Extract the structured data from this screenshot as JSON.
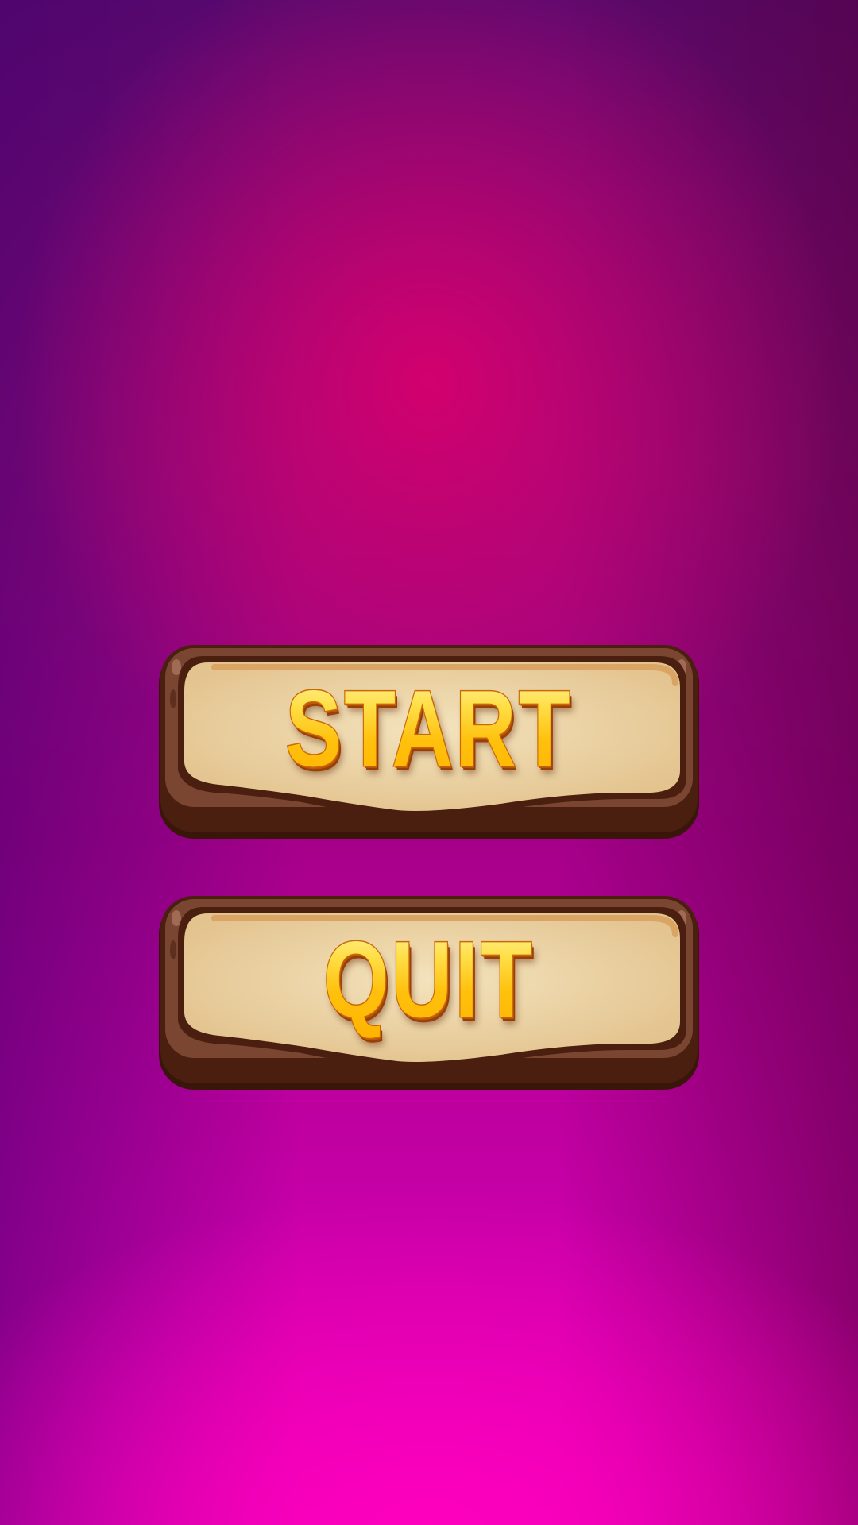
{
  "menu": {
    "start_label": "START",
    "quit_label": "QUIT"
  },
  "colors": {
    "background_top": "#5a0a6e",
    "background_bottom": "#e600b4",
    "wood_dark": "#4a1f10",
    "wood_mid": "#7a4632",
    "parchment": "#ecd7a8",
    "label_gold": "#ffc51a"
  }
}
